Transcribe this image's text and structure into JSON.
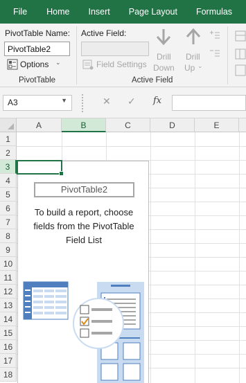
{
  "menu": [
    "File",
    "Home",
    "Insert",
    "Page Layout",
    "Formulas"
  ],
  "ribbon": {
    "pivot_name_label": "PivotTable Name:",
    "pivot_name_value": "PivotTable2",
    "options_label": "Options",
    "group_pivottable": "PivotTable",
    "active_field_label": "Active Field:",
    "active_field_value": "",
    "field_settings_label": "Field Settings",
    "drill_down_line1": "Drill",
    "drill_down_line2": "Down",
    "drill_up_line1": "Drill",
    "drill_up_line2": "Up",
    "group_active_field": "Active Field"
  },
  "formula_bar": {
    "name_box": "A3",
    "cancel_icon": "✕",
    "enter_icon": "✓",
    "fx_label": "fx",
    "formula": ""
  },
  "grid": {
    "columns": [
      "A",
      "B",
      "C",
      "D",
      "E"
    ],
    "rows": [
      "1",
      "2",
      "3",
      "4",
      "5",
      "6",
      "7",
      "8",
      "9",
      "10",
      "11",
      "12",
      "13",
      "14",
      "15",
      "16",
      "17",
      "18"
    ],
    "selected_column": "B",
    "active_cell": "A3"
  },
  "pivot_placeholder": {
    "name": "PivotTable2",
    "message": "To build a report, choose fields from the PivotTable Field List"
  },
  "colors": {
    "accent": "#217346",
    "ribbon_bg": "#f3f3f3",
    "illustration_blue": "#4f7fbf",
    "illustration_light": "#c9dbf1",
    "check_orange": "#d88b1b"
  },
  "icons": [
    "options-icon",
    "dropdown-icon",
    "field-settings-icon",
    "drill-down-icon",
    "drill-up-icon",
    "expand-field-icon",
    "collapse-field-icon",
    "name-box-dropdown-icon",
    "cancel-icon",
    "enter-icon",
    "fx-icon"
  ]
}
